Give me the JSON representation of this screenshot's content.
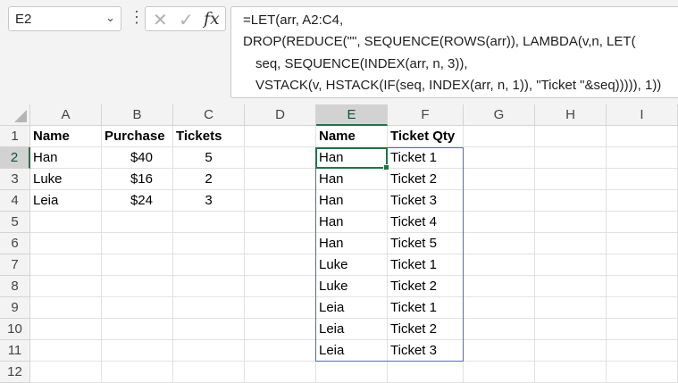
{
  "namebox": {
    "value": "E2"
  },
  "formula_bar": {
    "lines": [
      "=LET(arr, A2:C4,",
      "DROP(REDUCE(\"\", SEQUENCE(ROWS(arr)), LAMBDA(v,n, LET(",
      "seq, SEQUENCE(INDEX(arr, n, 3)),",
      "VSTACK(v, HSTACK(IF(seq, INDEX(arr, n, 1)), \"Ticket \"&seq))))), 1))"
    ],
    "cancel_icon": "x-icon",
    "enter_icon": "check-icon",
    "fx_icon": "fx"
  },
  "columns": [
    "A",
    "B",
    "C",
    "D",
    "E",
    "F",
    "G",
    "H",
    "I"
  ],
  "rows": [
    "1",
    "2",
    "3",
    "4",
    "5",
    "6",
    "7",
    "8",
    "9",
    "10",
    "11",
    "12"
  ],
  "source_table": {
    "headers": [
      "Name",
      "Purchase",
      "Tickets"
    ],
    "rows": [
      [
        "Han",
        "$40",
        "5"
      ],
      [
        "Luke",
        "$16",
        "2"
      ],
      [
        "Leia",
        "$24",
        "3"
      ]
    ]
  },
  "result_table": {
    "headers": [
      "Name",
      "Ticket Qty"
    ],
    "rows": [
      [
        "Han",
        "Ticket 1"
      ],
      [
        "Han",
        "Ticket 2"
      ],
      [
        "Han",
        "Ticket 3"
      ],
      [
        "Han",
        "Ticket 4"
      ],
      [
        "Han",
        "Ticket 5"
      ],
      [
        "Luke",
        "Ticket 1"
      ],
      [
        "Luke",
        "Ticket 2"
      ],
      [
        "Leia",
        "Ticket 1"
      ],
      [
        "Leia",
        "Ticket 2"
      ],
      [
        "Leia",
        "Ticket 3"
      ]
    ]
  },
  "colors": {
    "active": "#217346",
    "spill": "#4472c4"
  }
}
